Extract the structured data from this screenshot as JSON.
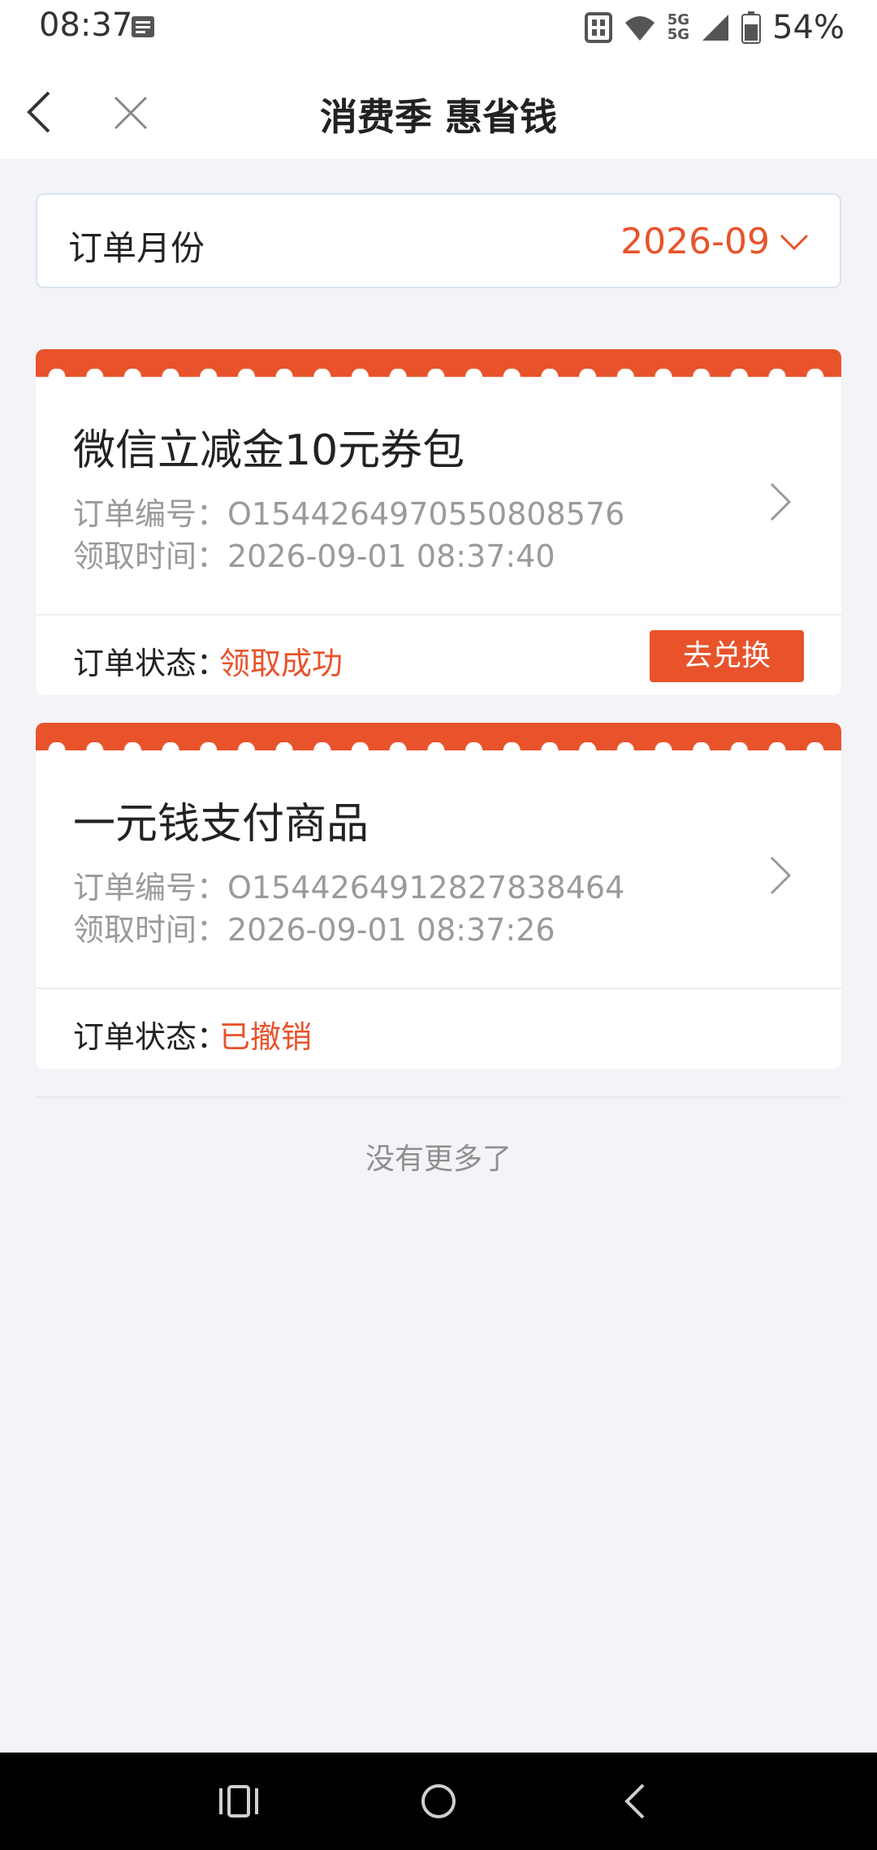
{
  "status_bar": {
    "time": "08:37",
    "battery_percent": "54%",
    "network_label_top": "5G",
    "network_label_bottom": "5G",
    "icons": [
      "notification-icon",
      "signal-icon",
      "wifi-icon",
      "cellular-icon",
      "battery-icon"
    ]
  },
  "nav": {
    "title": "消费季 惠省钱"
  },
  "month_selector": {
    "label": "订单月份",
    "value": "2026-09"
  },
  "orders": [
    {
      "title": "微信立减金10元券包",
      "order_no": "订单编号：O1544264970550808576",
      "time": "领取时间：2026-09-01 08:37:40",
      "status_label": "订单状态：",
      "status_value": "领取成功",
      "action_label": "去兑换"
    },
    {
      "title": "一元钱支付商品",
      "order_no": "订单编号：O1544264912827838464",
      "time": "领取时间：2026-09-01 08:37:26",
      "status_label": "订单状态：",
      "status_value": "已撤销"
    }
  ],
  "footer": {
    "no_more": "没有更多了"
  },
  "colors": {
    "accent": "#e8532b",
    "background": "#f3f3f8"
  }
}
